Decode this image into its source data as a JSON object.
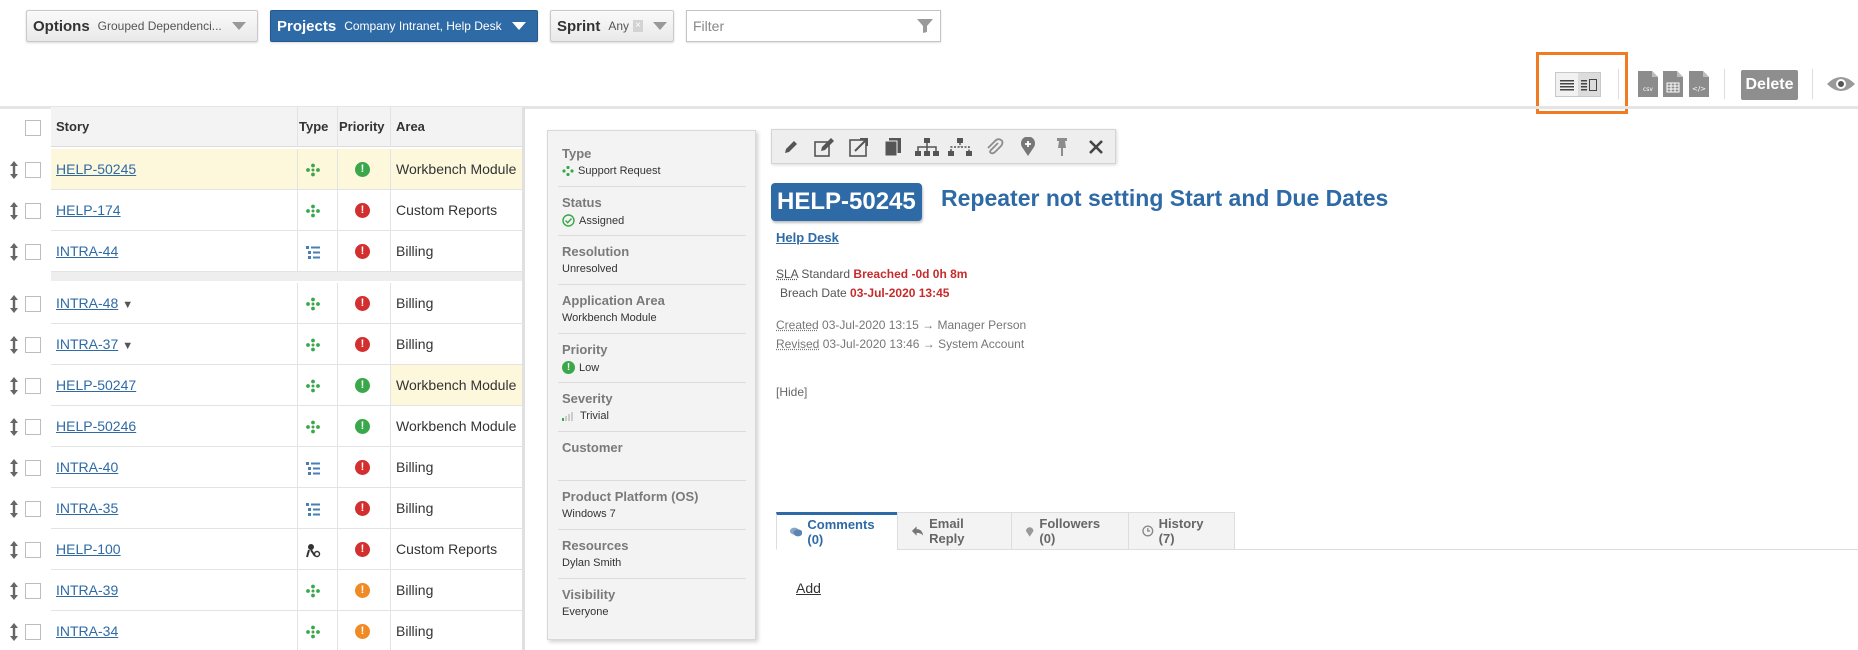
{
  "filters": {
    "options_label": "Options",
    "options_value": "Grouped Dependenci...",
    "projects_label": "Projects",
    "projects_value": "Company Intranet, Help Desk",
    "sprint_label": "Sprint",
    "sprint_value": "Any",
    "filter_placeholder": "Filter"
  },
  "toolbar": {
    "delete_label": "Delete"
  },
  "grid": {
    "headers": {
      "story": "Story",
      "type": "Type",
      "priority": "Priority",
      "area": "Area"
    },
    "rows": [
      {
        "id": "HELP-50245",
        "type": "support-request-icon",
        "priority": "low",
        "area": "Workbench Module",
        "row_highlight": true,
        "area_highlight": false,
        "expand": ""
      },
      {
        "id": "HELP-174",
        "type": "support-request-icon",
        "priority": "high",
        "area": "Custom Reports",
        "row_highlight": false,
        "area_highlight": false,
        "expand": ""
      },
      {
        "id": "INTRA-44",
        "type": "task-list-icon",
        "priority": "high",
        "area": "Billing",
        "row_highlight": false,
        "area_highlight": false,
        "expand": ""
      },
      {
        "id": "INTRA-48",
        "type": "support-request-icon",
        "priority": "high",
        "area": "Billing",
        "row_highlight": false,
        "area_highlight": false,
        "expand": "▼"
      },
      {
        "id": "INTRA-37",
        "type": "support-request-icon",
        "priority": "high",
        "area": "Billing",
        "row_highlight": false,
        "area_highlight": false,
        "expand": "▼"
      },
      {
        "id": "HELP-50247",
        "type": "support-request-icon",
        "priority": "low",
        "area": "Workbench Module",
        "row_highlight": false,
        "area_highlight": true,
        "expand": ""
      },
      {
        "id": "HELP-50246",
        "type": "support-request-icon",
        "priority": "low",
        "area": "Workbench Module",
        "row_highlight": false,
        "area_highlight": false,
        "expand": ""
      },
      {
        "id": "INTRA-40",
        "type": "task-list-icon",
        "priority": "high",
        "area": "Billing",
        "row_highlight": false,
        "area_highlight": false,
        "expand": ""
      },
      {
        "id": "INTRA-35",
        "type": "task-list-icon",
        "priority": "high",
        "area": "Billing",
        "row_highlight": false,
        "area_highlight": false,
        "expand": ""
      },
      {
        "id": "HELP-100",
        "type": "bug-icon",
        "priority": "high",
        "area": "Custom Reports",
        "row_highlight": false,
        "area_highlight": false,
        "expand": ""
      },
      {
        "id": "INTRA-39",
        "type": "support-request-icon",
        "priority": "medium",
        "area": "Billing",
        "row_highlight": false,
        "area_highlight": false,
        "expand": ""
      },
      {
        "id": "INTRA-34",
        "type": "support-request-icon",
        "priority": "medium",
        "area": "Billing",
        "row_highlight": false,
        "area_highlight": false,
        "expand": ""
      }
    ]
  },
  "details": {
    "type_label": "Type",
    "type_value": "Support Request",
    "status_label": "Status",
    "status_value": "Assigned",
    "resolution_label": "Resolution",
    "resolution_value": "Unresolved",
    "app_area_label": "Application Area",
    "app_area_value": "Workbench Module",
    "priority_label": "Priority",
    "priority_value": "Low",
    "severity_label": "Severity",
    "severity_value": "Trivial",
    "customer_label": "Customer",
    "customer_value": "",
    "platform_label": "Product Platform (OS)",
    "platform_value": "Windows 7",
    "resources_label": "Resources",
    "resources_value": "Dylan Smith",
    "visibility_label": "Visibility",
    "visibility_value": "Everyone"
  },
  "item": {
    "key": "HELP-50245",
    "title": "Repeater not setting Start and Due Dates",
    "project": "Help Desk",
    "sla_label": "SLA",
    "sla_name": "Standard",
    "sla_status": "Breached -0d 0h 8m",
    "breach_label": "Breach Date",
    "breach_date": "03-Jul-2020 13:45",
    "created_label": "Created",
    "created_value": "03-Jul-2020 13:15 → Manager Person",
    "revised_label": "Revised",
    "revised_value": "03-Jul-2020 13:46 → System Account",
    "hide_label": "[Hide]"
  },
  "tabs": [
    {
      "label": "Comments (0)",
      "active": true
    },
    {
      "label": "Email Reply",
      "active": false
    },
    {
      "label": "Followers (0)",
      "active": false
    },
    {
      "label": "History (7)",
      "active": false
    }
  ],
  "comments": {
    "add_label": "Add"
  },
  "colors": {
    "accent": "#2e6aa6",
    "priority_low": "#3aa84a",
    "priority_high": "#d32f2f",
    "priority_medium": "#f08a24",
    "breach_red": "#c72b2b",
    "highlight_box": "#f07b22"
  }
}
